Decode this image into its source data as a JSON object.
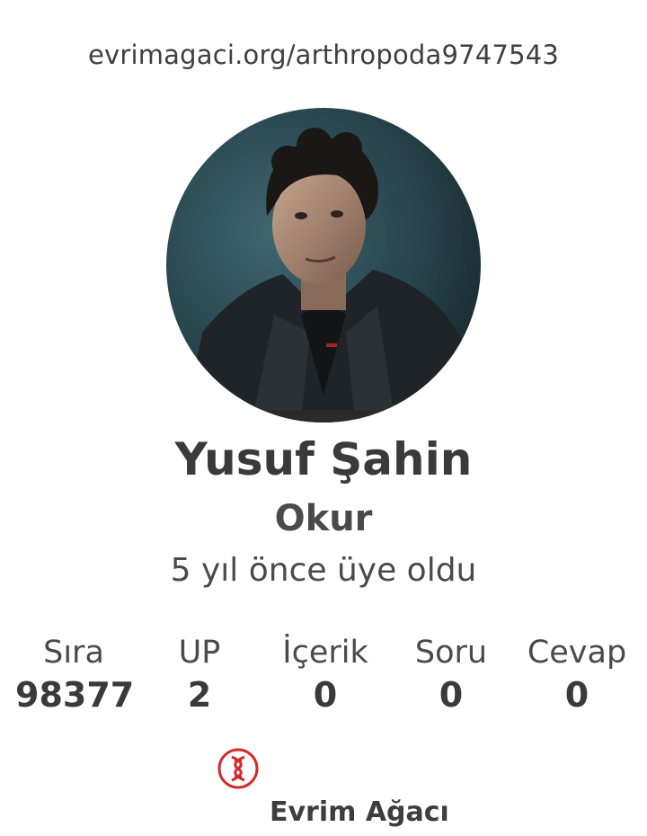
{
  "profile_url": "evrimagaci.org/arthropoda9747543",
  "user": {
    "name": "Yusuf Şahin",
    "role": "Okur",
    "member_since": "5 yıl önce üye oldu"
  },
  "stats": [
    {
      "label": "Sıra",
      "value": "98377"
    },
    {
      "label": "UP",
      "value": "2"
    },
    {
      "label": "İçerik",
      "value": "0"
    },
    {
      "label": "Soru",
      "value": "0"
    },
    {
      "label": "Cevap",
      "value": "0"
    }
  ],
  "brand": {
    "name": "Evrim Ağacı",
    "logo_icon": "dna-logo-icon",
    "accent_color": "#d42a2a"
  }
}
